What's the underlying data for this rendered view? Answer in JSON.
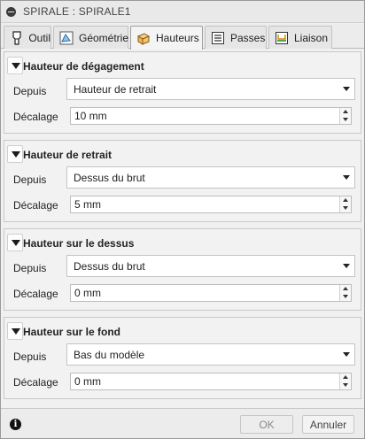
{
  "window": {
    "title": "SPIRALE : SPIRALE1"
  },
  "tabs": [
    {
      "label": "Outil",
      "icon": "tool-icon",
      "active": false
    },
    {
      "label": "Géométrie",
      "icon": "geometry-icon",
      "active": false
    },
    {
      "label": "Hauteurs",
      "icon": "heights-icon",
      "active": true
    },
    {
      "label": "Passes",
      "icon": "passes-icon",
      "active": false
    },
    {
      "label": "Liaison",
      "icon": "linking-icon",
      "active": false
    }
  ],
  "sections": [
    {
      "title": "Hauteur de dégagement",
      "from_label": "Depuis",
      "from_value": "Hauteur de retrait",
      "offset_label": "Décalage",
      "offset_value": "10 mm"
    },
    {
      "title": "Hauteur de retrait",
      "from_label": "Depuis",
      "from_value": "Dessus du brut",
      "offset_label": "Décalage",
      "offset_value": "5 mm"
    },
    {
      "title": "Hauteur sur le dessus",
      "from_label": "Depuis",
      "from_value": "Dessus du brut",
      "offset_label": "Décalage",
      "offset_value": "0 mm"
    },
    {
      "title": "Hauteur sur le fond",
      "from_label": "Depuis",
      "from_value": "Bas du modèle",
      "offset_label": "Décalage",
      "offset_value": "0 mm"
    }
  ],
  "footer": {
    "info_icon": "i",
    "ok_label": "OK",
    "cancel_label": "Annuler"
  }
}
